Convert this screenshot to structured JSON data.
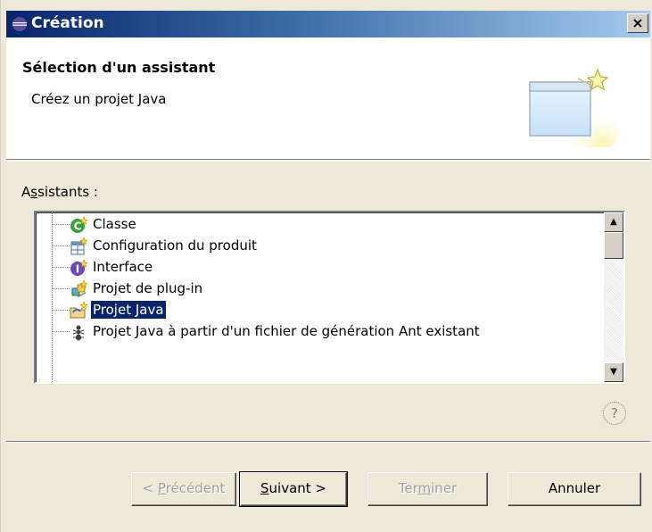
{
  "window": {
    "title": "Création",
    "close_label": "×"
  },
  "banner": {
    "title": "Sélection d'un assistant",
    "description": "Créez un projet Java"
  },
  "wizards": {
    "label_prefix": "A",
    "label_mnemonic": "s",
    "label_suffix": "sistants :",
    "items": [
      {
        "label": "Classe",
        "icon": "class-icon",
        "selected": false
      },
      {
        "label": "Configuration du produit",
        "icon": "product-config-icon",
        "selected": false
      },
      {
        "label": "Interface",
        "icon": "interface-icon",
        "selected": false
      },
      {
        "label": "Projet de plug-in",
        "icon": "plugin-project-icon",
        "selected": false
      },
      {
        "label": "Projet Java",
        "icon": "java-project-icon",
        "selected": true
      },
      {
        "label": "Projet Java à partir d'un fichier de génération Ant existant",
        "icon": "ant-icon",
        "selected": false
      }
    ]
  },
  "help": {
    "label": "?"
  },
  "buttons": {
    "back": {
      "prefix": "< ",
      "mnemonic": "P",
      "suffix": "récédent"
    },
    "next": {
      "mnemonic": "S",
      "suffix": "uivant >"
    },
    "finish": {
      "prefix": "Ter",
      "mnemonic": "m",
      "suffix": "iner"
    },
    "cancel": {
      "label": "Annuler"
    }
  },
  "colors": {
    "selection": "#0a246a",
    "dialog_bg": "#ece9d8"
  }
}
